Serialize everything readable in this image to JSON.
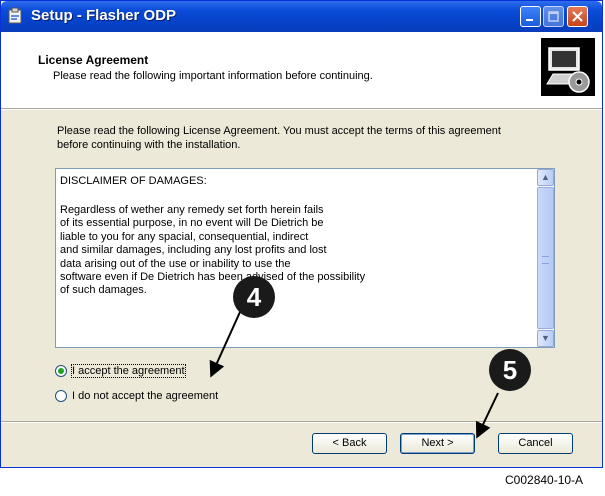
{
  "window": {
    "title": "Setup - Flasher ODP"
  },
  "header": {
    "title": "License Agreement",
    "subtitle": "Please read the following important information before continuing."
  },
  "intro": "Please read the following License Agreement. You must accept the terms of this agreement before continuing with the installation.",
  "license": {
    "heading": "DISCLAIMER OF DAMAGES:",
    "body": "Regardless of wether any remedy set forth herein fails\nof its essential purpose, in no event will De Dietrich be\nliable to you for any spacial, consequential, indirect\nand similar damages, including any lost profits and lost\ndata arising out of the use or inability to use the\nsoftware even if De Dietrich has been advised of the possibility\nof such damages."
  },
  "radios": {
    "accept": {
      "label": "I accept the agreement",
      "selected": true
    },
    "decline": {
      "label": "I do not accept the agreement",
      "selected": false
    }
  },
  "buttons": {
    "back": "< Back",
    "next": "Next >",
    "cancel": "Cancel"
  },
  "callouts": {
    "first": "4",
    "second": "5"
  },
  "caption": "C002840-10-A",
  "colors": {
    "titlebar": "#0a4cd8",
    "dialog": "#ece9d8",
    "callout": "#1a1a1a"
  },
  "icons": [
    "setup-app-icon",
    "minimize-icon",
    "maximize-icon",
    "close-icon",
    "computer-disk-icon",
    "scroll-up-icon",
    "scroll-down-icon"
  ]
}
